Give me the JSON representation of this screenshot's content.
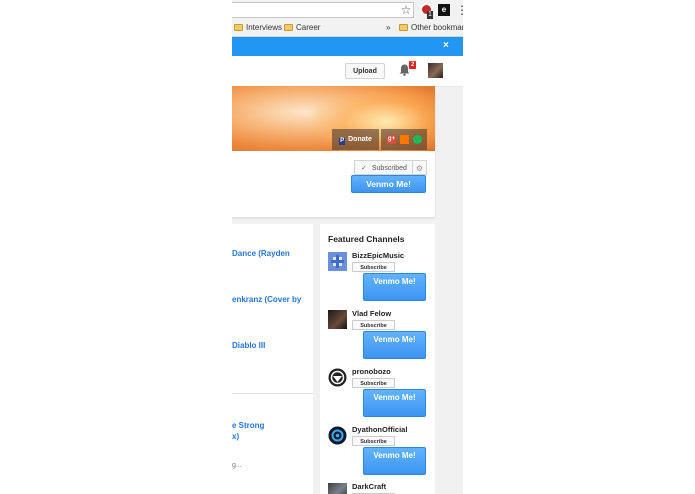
{
  "browser": {
    "star_icon": "star-icon",
    "ext_badge": "1",
    "ext_dark_label": "e",
    "menu_icon": "⋮",
    "bookmarks": [
      "Interviews",
      "Career",
      "Other bookmarks"
    ],
    "bookmarks_overflow": "»",
    "notification_close": "×"
  },
  "header": {
    "upload_label": "Upload",
    "notification_count": "2"
  },
  "channel": {
    "donate_label": "Donate",
    "social": [
      "g+",
      "soundcloud",
      "spotify"
    ],
    "subscribed_label": "Subscribed",
    "venmo_label": "Venmo Me!"
  },
  "videos": [
    {
      "title_lines": [
        "Dance (Rayden"
      ]
    },
    {
      "title_lines": [
        "enkranz (Cover by"
      ]
    },
    {
      "title_lines": [
        "Diablo III"
      ]
    },
    {
      "title_lines": [
        "e Strong",
        "x)"
      ]
    }
  ],
  "videos_meta": "g...",
  "featured": {
    "title": "Featured Channels",
    "subscribe_label": "Subscribe",
    "venmo_label": "Venmo Me!",
    "channels": [
      {
        "name": "BizzEpicMusic"
      },
      {
        "name": "Vlad Felow"
      },
      {
        "name": "pronobozo"
      },
      {
        "name": "DyathonOfficial"
      },
      {
        "name": "DarkCraft"
      }
    ]
  },
  "colors": {
    "venmo_blue": "#3d95f0",
    "link_blue": "#2576d6",
    "notification_bar": "#2196f3",
    "badge_red": "#e62117"
  }
}
